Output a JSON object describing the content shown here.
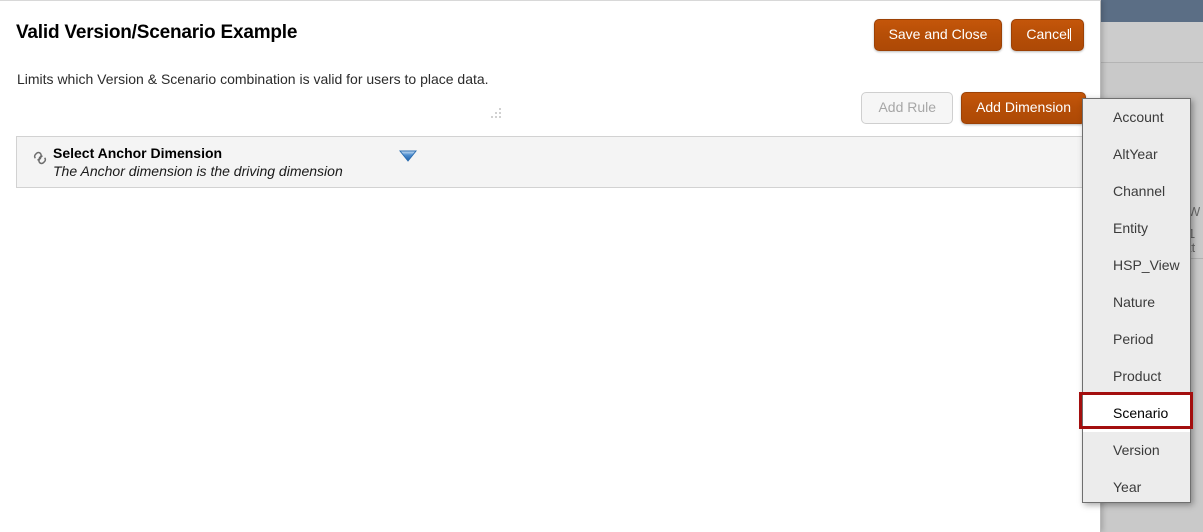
{
  "dialog": {
    "title": "Valid Version/Scenario Example",
    "subtitle": "Limits which Version & Scenario combination is valid for users to place data."
  },
  "top_actions": {
    "save_label": "Save and Close",
    "cancel_label": "Cancel"
  },
  "row_actions": {
    "add_rule_label": "Add Rule",
    "add_dimension_label": "Add Dimension"
  },
  "anchor": {
    "title": "Select Anchor Dimension",
    "description": "The Anchor dimension is the driving dimension",
    "icon": "link-icon",
    "arrow_icon": "chevron-down-icon"
  },
  "dimension_menu": {
    "items": [
      {
        "label": "Account",
        "selected": false
      },
      {
        "label": "AltYear",
        "selected": false
      },
      {
        "label": "Channel",
        "selected": false
      },
      {
        "label": "Entity",
        "selected": false
      },
      {
        "label": "HSP_View",
        "selected": false
      },
      {
        "label": "Nature",
        "selected": false
      },
      {
        "label": "Period",
        "selected": false
      },
      {
        "label": "Product",
        "selected": false
      },
      {
        "label": "Scenario",
        "selected": true
      },
      {
        "label": "Version",
        "selected": false
      },
      {
        "label": "Year",
        "selected": false
      }
    ],
    "highlighted_item": "Scenario"
  },
  "background_app": {
    "text_fragments": [
      "W",
      "1",
      "tt"
    ]
  },
  "colors": {
    "primary_button": "#b64e07",
    "highlight_border": "#a30e0e",
    "panel_background": "#f4f4f4",
    "menu_background": "#ececec",
    "bg_app_header": "#5b6e85"
  }
}
